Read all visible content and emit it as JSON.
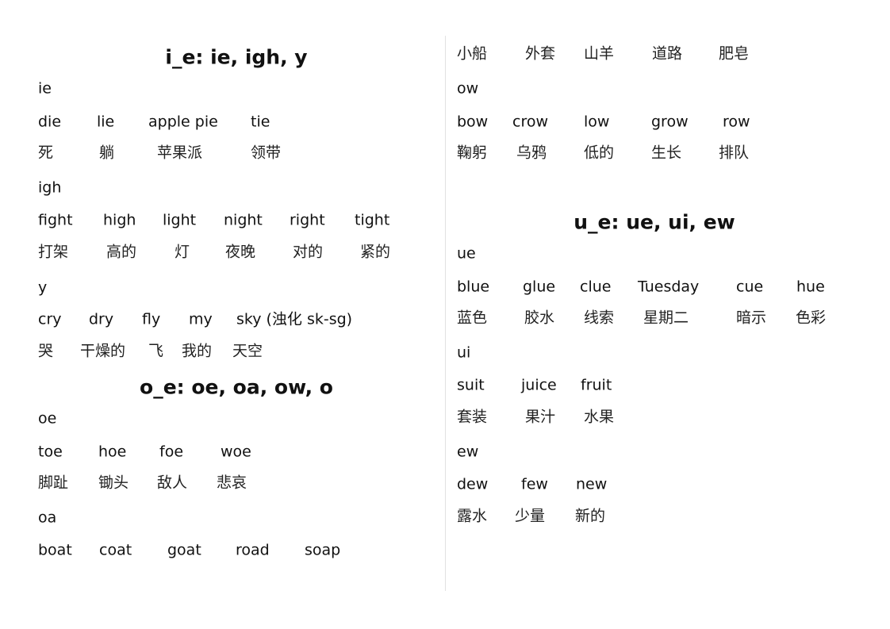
{
  "left": {
    "title_1": "i_e: ie, igh, y",
    "rows": [
      [
        "ie"
      ],
      [
        "die",
        "lie",
        "apple pie",
        "tie"
      ],
      [
        "死",
        "躺",
        "苹果派",
        "领带"
      ],
      [
        "igh"
      ],
      [
        "fight",
        "high",
        "light",
        "night",
        "right",
        "tight"
      ],
      [
        "打架",
        "高的",
        "灯",
        "夜晚",
        "对的",
        "紧的"
      ],
      [
        "y"
      ],
      [
        "cry",
        "dry",
        "fly",
        "my",
        "sky (浊化 sk-sg)"
      ],
      [
        "哭",
        "干燥的",
        "飞",
        "我的",
        "天空"
      ]
    ],
    "title_2": "o_e: oe, oa, ow, o",
    "rows_2": [
      [
        "oe"
      ],
      [
        "toe",
        "hoe",
        "foe",
        "woe"
      ],
      [
        "脚趾",
        "锄头",
        "敌人",
        "悲哀"
      ],
      [
        "oa"
      ],
      [
        "boat",
        "coat",
        "goat",
        "road",
        "soap"
      ]
    ]
  },
  "right": {
    "rows": [
      [
        "小船",
        "外套",
        "山羊",
        "道路",
        "肥皂"
      ],
      [
        "ow"
      ],
      [
        "bow",
        "crow",
        "low",
        "grow",
        "row"
      ],
      [
        "鞠躬",
        "乌鸦",
        "低的",
        "生长",
        "排队"
      ]
    ],
    "title_3": "u_e: ue, ui, ew",
    "rows_2": [
      [
        "ue"
      ],
      [
        "blue",
        "glue",
        "clue",
        "Tuesday",
        "cue",
        "hue"
      ],
      [
        "蓝色",
        "胶水",
        "线索",
        "星期二",
        "暗示",
        "色彩"
      ],
      [
        "ui"
      ],
      [
        "suit",
        "juice",
        "fruit"
      ],
      [
        "套装",
        "果汁",
        "水果"
      ],
      [
        "ew"
      ],
      [
        "dew",
        "few",
        "new"
      ],
      [
        "露水",
        "少量",
        "新的"
      ]
    ]
  }
}
